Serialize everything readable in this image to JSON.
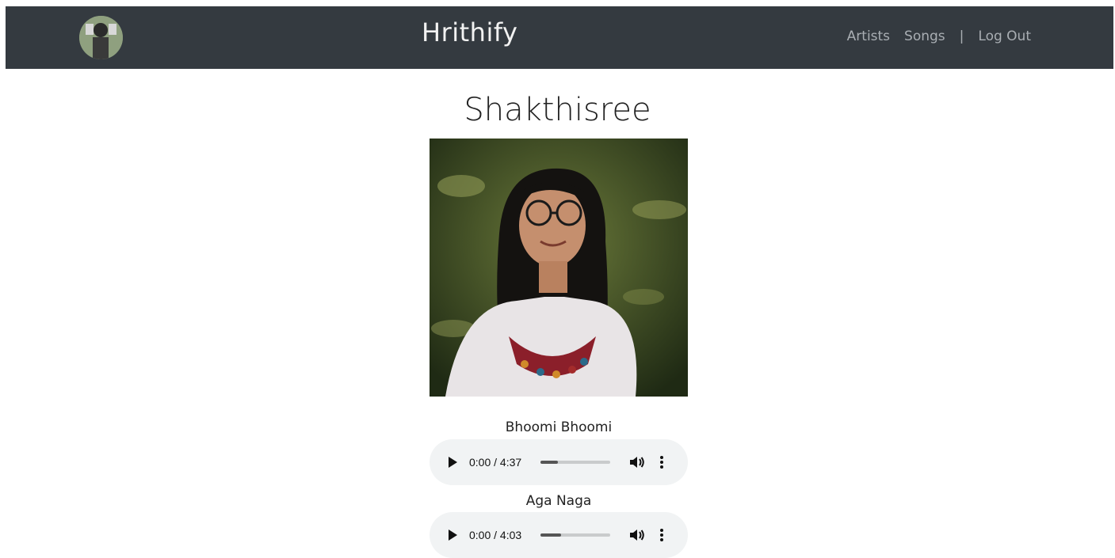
{
  "header": {
    "brand": "Hrithify",
    "nav": {
      "artists": "Artists",
      "songs": "Songs",
      "separator": "|",
      "logout": "Log Out"
    },
    "avatar_icon": "profile-avatar"
  },
  "artist": {
    "name": "Shakthisree"
  },
  "songs": [
    {
      "title": "Bhoomi Bhoomi",
      "time": "0:00 / 4:37",
      "volume_level": 0.25
    },
    {
      "title": "Aga Naga",
      "time": "0:00 / 4:03",
      "volume_level": 0.3
    }
  ],
  "colors": {
    "navbar_bg": "#343a40",
    "nav_text": "#a9aeb3",
    "player_bg": "#f1f3f4"
  }
}
